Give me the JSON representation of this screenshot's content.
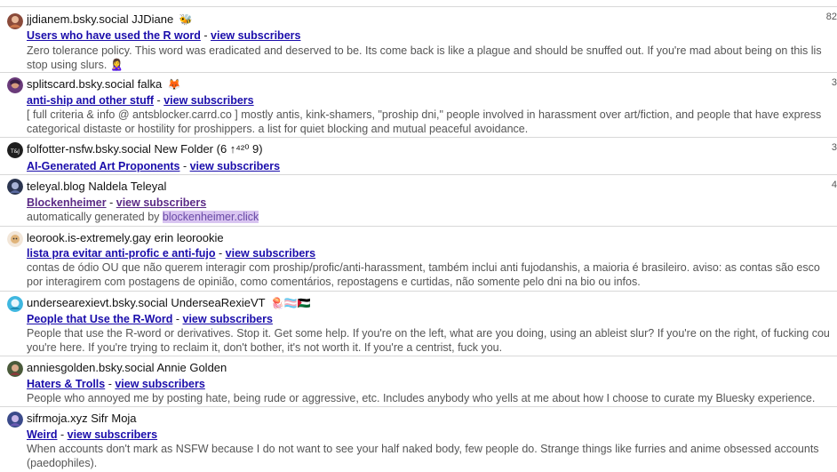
{
  "rows": [
    {
      "handle": "jjdianem.bsky.social",
      "display": "JJDiane",
      "emoji": "🐝",
      "list_title": "Users who have used the R word",
      "view_label": "view subscribers",
      "desc_lines": [
        "Zero tolerance policy. This word was eradicated and deserved to be. Its come back is like a plague and should be snuffed out. If you're mad about being on this lis",
        "stop using slurs. 🙎‍♀️"
      ],
      "count": "82"
    },
    {
      "handle": "splitscard.bsky.social",
      "display": "falka",
      "emoji": "🦊",
      "list_title": "anti-ship and other stuff",
      "view_label": "view subscribers",
      "desc_lines": [
        "[ full criteria & info @ antsblocker.carrd.co ] mostly antis, kink-shamers, \"proship dni,\" people involved in harassment over art/fiction, and people that have express",
        "categorical distaste or hostility for proshippers. a list for quiet blocking and mutual peaceful avoidance."
      ],
      "count": "3"
    },
    {
      "handle": "folfotter-nsfw.bsky.social",
      "display": "New Folder (6 ↑⁴²⁰ 9)",
      "emoji": "",
      "list_title": "AI-Generated Art Proponents",
      "view_label": "view subscribers",
      "desc_lines": [],
      "count": "3"
    },
    {
      "handle": "teleyal.blog",
      "display": "Naldela Teleyal",
      "emoji": "",
      "list_title": "Blockenheimer",
      "view_label": "view subscribers",
      "desc_prefix": "automatically generated by ",
      "desc_highlight": "blockenheimer.click",
      "desc_lines": [],
      "count": "4"
    },
    {
      "handle": "leorook.is-extremely.gay",
      "display": "erin leorookie",
      "emoji": "",
      "list_title": "lista pra evitar anti-profic e anti-fujo",
      "view_label": "view subscribers",
      "desc_lines": [
        "contas de ódio OU que não querem interagir com proship/profic/anti-harassment, também inclui anti fujodanshis, a maioria é brasileiro. aviso: as contas são esco",
        "por interagirem com postagens de opinião, como comentários, repostagens e curtidas, não somente pelo dni na bio ou infos."
      ],
      "count": ""
    },
    {
      "handle": "undersearexievt.bsky.social",
      "display": "UnderseaRexieVT",
      "emoji": "🪼🏳️‍⚧️🇵🇸",
      "list_title": "People that Use the R-Word",
      "view_label": "view subscribers",
      "desc_lines": [
        "People that use the R-word or derivatives. Stop it. Get some help. If you're on the left, what are you doing, using an ableist slur? If you're on the right, of fucking cou",
        "you're here. If you're trying to reclaim it, don't bother, it's not worth it. If you're a centrist, fuck you."
      ],
      "count": ""
    },
    {
      "handle": "anniesgolden.bsky.social",
      "display": "Annie Golden",
      "emoji": "",
      "list_title": "Haters & Trolls",
      "view_label": "view subscribers",
      "desc_lines": [
        "People who annoyed me by posting hate, being rude or aggressive, etc. Includes anybody who yells at me about how I choose to curate my Bluesky experience."
      ],
      "count": ""
    },
    {
      "handle": "sifrmoja.xyz",
      "display": "Sifr Moja",
      "emoji": "",
      "list_title": "Weird",
      "view_label": "view subscribers",
      "desc_lines": [
        "When accounts don't mark as NSFW because I do not want to see your half naked body, few people do. Strange things like furries and anime obsessed accounts",
        "(paedophiles)."
      ],
      "count": ""
    }
  ],
  "colors": {
    "link": "#1a0dab",
    "visited": "#5b2a86",
    "highlight": "#d8c4f0"
  }
}
